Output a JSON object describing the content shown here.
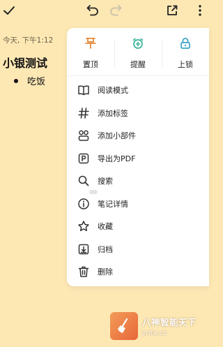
{
  "toolbar": {
    "icons": [
      "check-icon",
      "undo-icon",
      "redo-icon",
      "share-icon",
      "more-icon"
    ]
  },
  "note": {
    "timestamp": "今天, 下午1:12",
    "title": "小银测试",
    "bullets": [
      "吃饭"
    ]
  },
  "menu": {
    "quick_actions": [
      {
        "label": "置顶",
        "icon": "pin-icon",
        "color": "#e8893a"
      },
      {
        "label": "提醒",
        "icon": "alarm-icon",
        "color": "#35b39a"
      },
      {
        "label": "上锁",
        "icon": "lock-icon",
        "color": "#3ba5c7"
      }
    ],
    "items": [
      {
        "label": "阅读模式",
        "icon": "book-icon"
      },
      {
        "label": "添加标签",
        "icon": "hashtag-icon"
      },
      {
        "label": "添加小部件",
        "icon": "widget-icon"
      },
      {
        "label": "导出为PDF",
        "icon": "pdf-icon"
      },
      {
        "label": "搜索",
        "icon": "search-icon"
      },
      {
        "label": "笔记详情",
        "icon": "info-icon"
      },
      {
        "label": "收藏",
        "icon": "star-icon"
      },
      {
        "label": "归档",
        "icon": "archive-icon"
      },
      {
        "label": "删除",
        "icon": "trash-icon"
      }
    ]
  },
  "watermark": {
    "main": "八神智能天下",
    "sub": "zntx.cc"
  },
  "colors": {
    "background": "#fde8b4",
    "menu_bg": "#ffffff",
    "text": "#222222"
  }
}
